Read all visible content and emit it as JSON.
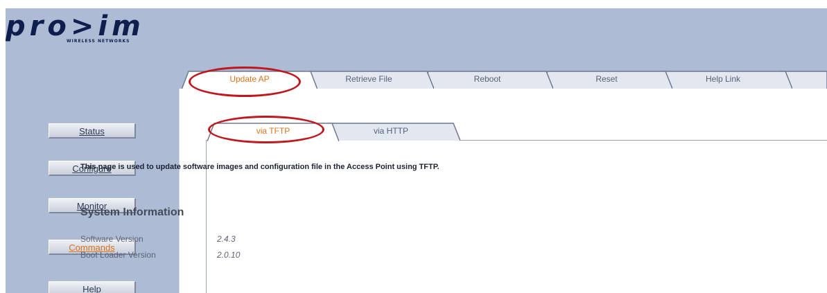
{
  "logo": {
    "wordmark": "pro>im",
    "tagline": "WIRELESS NETWORKS"
  },
  "nav": [
    {
      "label": "Status",
      "active": false
    },
    {
      "label": "Configure",
      "active": false
    },
    {
      "label": "Monitor",
      "active": false
    },
    {
      "label": "Commands",
      "active": true
    },
    {
      "label": "Help",
      "active": false
    }
  ],
  "tabs": [
    {
      "label": "Update AP",
      "selected": true
    },
    {
      "label": "Retrieve File",
      "selected": false
    },
    {
      "label": "Reboot",
      "selected": false
    },
    {
      "label": "Reset",
      "selected": false
    },
    {
      "label": "Help Link",
      "selected": false
    }
  ],
  "subtabs": [
    {
      "label": "via TFTP",
      "selected": true
    },
    {
      "label": "via HTTP",
      "selected": false
    }
  ],
  "content": {
    "description": "This page is used to update software images and configuration file in the Access Point using TFTP.",
    "section_title": "System Information",
    "rows": [
      {
        "label": "Software Version",
        "value": "2.4.3"
      },
      {
        "label": "Boot Loader Version",
        "value": "2.0.10"
      }
    ]
  },
  "colors": {
    "frame_bg": "#aebbd4",
    "active_nav": "#d8731d",
    "highlight_oval": "#c0171e"
  }
}
